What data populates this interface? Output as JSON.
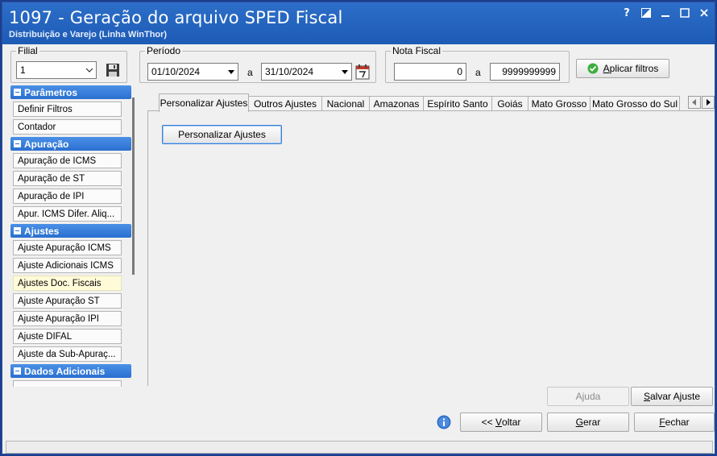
{
  "window": {
    "title": "1097 - Geração do arquivo SPED Fiscal",
    "subtitle": "Distribuição e Varejo (Linha WinThor)",
    "help_label": "?"
  },
  "filial": {
    "legend": "Filial",
    "value": "1"
  },
  "periodo": {
    "legend": "Período",
    "start": "01/10/2024",
    "separator": "a",
    "end": "31/10/2024"
  },
  "nota_fiscal": {
    "legend": "Nota Fiscal",
    "start": "0",
    "separator": "a",
    "end": "9999999999"
  },
  "filters": {
    "apply_prefix": "A",
    "apply_rest": "plicar filtros"
  },
  "sidebar": {
    "sections": [
      {
        "title": "Parâmetros",
        "items": [
          "Definir Filtros",
          "Contador"
        ]
      },
      {
        "title": "Apuração",
        "items": [
          "Apuração de ICMS",
          "Apuração de ST",
          "Apuração de IPI",
          "Apur. ICMS Difer. Aliq..."
        ]
      },
      {
        "title": "Ajustes",
        "items": [
          "Ajuste Apuração ICMS",
          "Ajuste Adicionais ICMS",
          "Ajustes Doc. Fiscais",
          "Ajuste Apuração ST",
          "Ajuste Apuração IPI",
          "Ajuste DIFAL",
          "Ajuste da Sub-Apuraç..."
        ]
      },
      {
        "title": "Dados Adicionais",
        "items": []
      }
    ]
  },
  "tabs": [
    "Personalizar Ajustes",
    "Outros Ajustes",
    "Nacional",
    "Amazonas",
    "Espírito Santo",
    "Goiás",
    "Mato Grosso",
    "Mato Grosso do Sul"
  ],
  "panel": {
    "button_label": "Personalizar Ajustes"
  },
  "actions": {
    "ajuda": "Ajuda",
    "salvar_prefix": "S",
    "salvar_rest": "alvar Ajuste",
    "voltar_prefix": "<< ",
    "voltar_key": "V",
    "voltar_rest": "oltar",
    "gerar_key": "G",
    "gerar_rest": "erar",
    "fechar_key": "F",
    "fechar_rest": "echar"
  },
  "colors": {
    "title_bar": "#2c6ec9",
    "section_header": "#3a80dc",
    "selected_item": "#fffbd9",
    "ok_icon": "#3cae3c"
  }
}
